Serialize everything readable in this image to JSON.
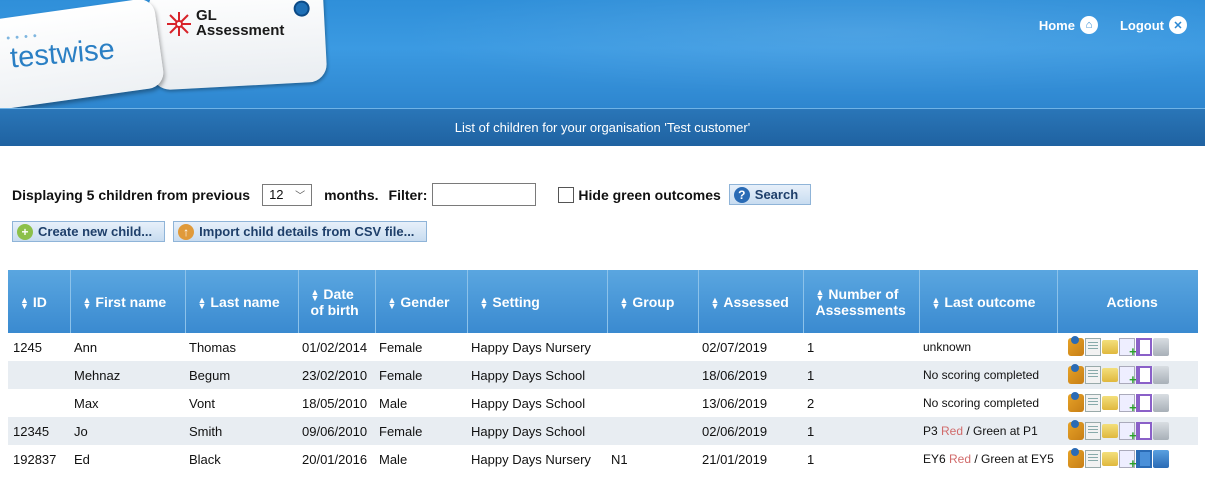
{
  "header": {
    "gl_logo_line1": "GL",
    "gl_logo_line2": "Assessment",
    "testwise_logo": "testwise",
    "home_label": "Home",
    "logout_label": "Logout",
    "home_icon": "home-icon",
    "logout_icon": "close-icon"
  },
  "banner": {
    "text": "List of children for your organisation 'Test customer'"
  },
  "filter": {
    "displaying_label": "Displaying 5 children from previous",
    "months_value": "12",
    "months_label": "months.",
    "filter_label": "Filter:",
    "filter_value": "",
    "hide_green_label": "Hide green outcomes",
    "hide_green_checked": false,
    "search_label": "Search"
  },
  "buttons": {
    "create_label": "Create new child...",
    "import_label": "Import child details from CSV file..."
  },
  "table": {
    "columns": [
      "ID",
      "First name",
      "Last name",
      "Date of birth",
      "Gender",
      "Setting",
      "Group",
      "Assessed",
      "Number of Assessments",
      "Last outcome",
      "Actions"
    ],
    "rows": [
      {
        "id": "1245",
        "first": "Ann",
        "last": "Thomas",
        "dob": "01/02/2014",
        "gender": "Female",
        "setting": "Happy Days Nursery",
        "group": "",
        "assessed": "02/07/2019",
        "num": "1",
        "outcome_a": "unknown",
        "outcome_red": "",
        "outcome_b": ""
      },
      {
        "id": "",
        "first": "Mehnaz",
        "last": "Begum",
        "dob": "23/02/2010",
        "gender": "Female",
        "setting": "Happy Days School",
        "group": "",
        "assessed": "18/06/2019",
        "num": "1",
        "outcome_a": "No scoring completed",
        "outcome_red": "",
        "outcome_b": ""
      },
      {
        "id": "",
        "first": "Max",
        "last": "Vont",
        "dob": "18/05/2010",
        "gender": "Male",
        "setting": "Happy Days School",
        "group": "",
        "assessed": "13/06/2019",
        "num": "2",
        "outcome_a": "No scoring completed",
        "outcome_red": "",
        "outcome_b": ""
      },
      {
        "id": "12345",
        "first": "Jo",
        "last": "Smith",
        "dob": "09/06/2010",
        "gender": "Female",
        "setting": "Happy Days School",
        "group": "",
        "assessed": "02/06/2019",
        "num": "1",
        "outcome_a": "P3 ",
        "outcome_red": "Red",
        "outcome_b": " / Green at P1"
      },
      {
        "id": "192837",
        "first": "Ed",
        "last": "Black",
        "dob": "20/01/2016",
        "gender": "Male",
        "setting": "Happy Days Nursery",
        "group": "N1",
        "assessed": "21/01/2019",
        "num": "1",
        "outcome_a": "EY6 ",
        "outcome_red": "Red",
        "outcome_b": " / Green at EY5"
      }
    ],
    "action_icons": [
      "edit-child-icon",
      "view-report-icon",
      "open-folder-icon",
      "add-assessment-icon",
      "print-page-icon",
      "delete-bin-icon"
    ]
  }
}
